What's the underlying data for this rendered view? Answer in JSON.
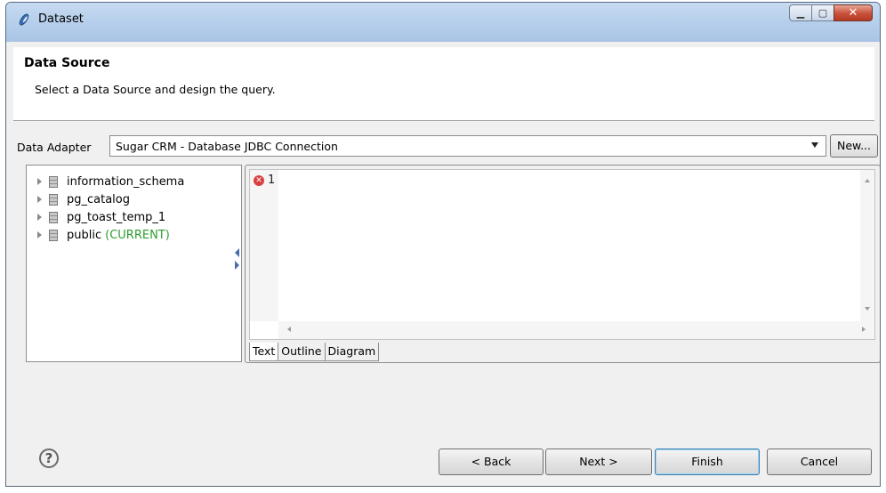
{
  "window": {
    "title": "Dataset",
    "controls": [
      "minimize",
      "maximize",
      "close"
    ]
  },
  "header": {
    "title": "Data Source",
    "subtitle": "Select a Data Source and design the query."
  },
  "adapter": {
    "label": "Data Adapter",
    "selected": "Sugar CRM - Database JDBC Connection",
    "new_button": "New..."
  },
  "tree": {
    "items": [
      {
        "label": "information_schema",
        "tag": ""
      },
      {
        "label": "pg_catalog",
        "tag": ""
      },
      {
        "label": "pg_toast_temp_1",
        "tag": ""
      },
      {
        "label": "public",
        "tag": "(CURRENT)"
      }
    ],
    "current_color": "#2e9d2e"
  },
  "editor": {
    "line_number": "1",
    "error_icon": "error-icon",
    "content": ""
  },
  "tabs": [
    "Text",
    "Outline",
    "Diagram"
  ],
  "active_tab": "Text",
  "footer": {
    "back": "< Back",
    "next": "Next >",
    "finish": "Finish",
    "cancel": "Cancel",
    "help_icon": "help-icon"
  }
}
